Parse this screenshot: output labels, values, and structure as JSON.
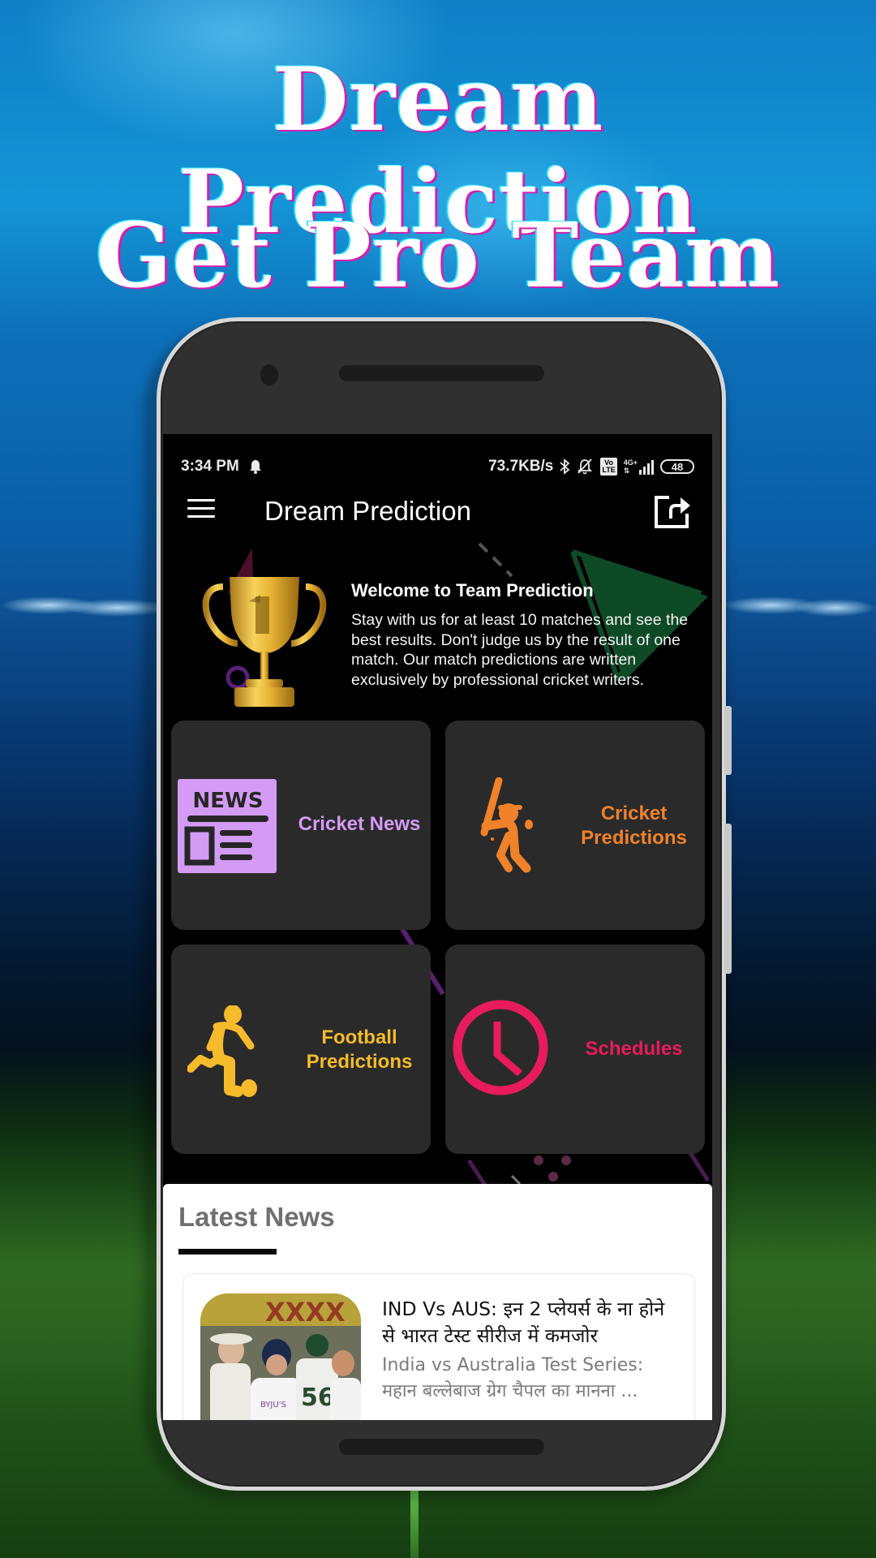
{
  "promo": {
    "headline_line1": "Dream Prediction",
    "headline_line2": "Get Pro Team"
  },
  "status_bar": {
    "time": "3:34 PM",
    "network_speed": "73.7KB/s",
    "network_type": "4G+",
    "volte_top": "Vo",
    "volte_bottom": "LTE",
    "battery": "48",
    "icons": [
      "notification-bell-icon",
      "bluetooth-icon",
      "bell-muted-icon",
      "volte-icon",
      "signal-icon",
      "battery-icon"
    ]
  },
  "app_bar": {
    "title": "Dream Prediction",
    "menu_icon": "hamburger-menu-icon",
    "share_icon": "share-icon"
  },
  "welcome": {
    "title": "Welcome to Team Prediction",
    "text": "Stay with us for at least 10 matches and see the best results. Don't judge us by the result of one match. Our match predictions are written exclusively by professional cricket writers.",
    "icon": "trophy-icon"
  },
  "tiles": [
    {
      "label": "Cricket News",
      "icon": "newspaper-icon",
      "color": "#d49bf5"
    },
    {
      "label": "Cricket Predictions",
      "icon": "cricket-batsman-icon",
      "color": "#f0822a"
    },
    {
      "label": "Football Predictions",
      "icon": "football-player-icon",
      "color": "#f5bb2a"
    },
    {
      "label": "Schedules",
      "icon": "clock-icon",
      "color": "#e81b5c"
    }
  ],
  "latest_news": {
    "heading": "Latest News",
    "items": [
      {
        "title": "IND Vs AUS: इन 2 प्लेयर्स के ना होने से भारत टेस्ट सीरीज में कमजोर",
        "description": "India vs Australia Test Series: महान बल्लेबाज ग्रेग चैपल का मानना ...",
        "thumbnail": "cricket-players-photo"
      }
    ]
  },
  "colors": {
    "screen_bg": "#000000",
    "tile_bg": "#2a2a2a",
    "phone_body": "#303030",
    "news_panel_bg": "#ffffff"
  }
}
